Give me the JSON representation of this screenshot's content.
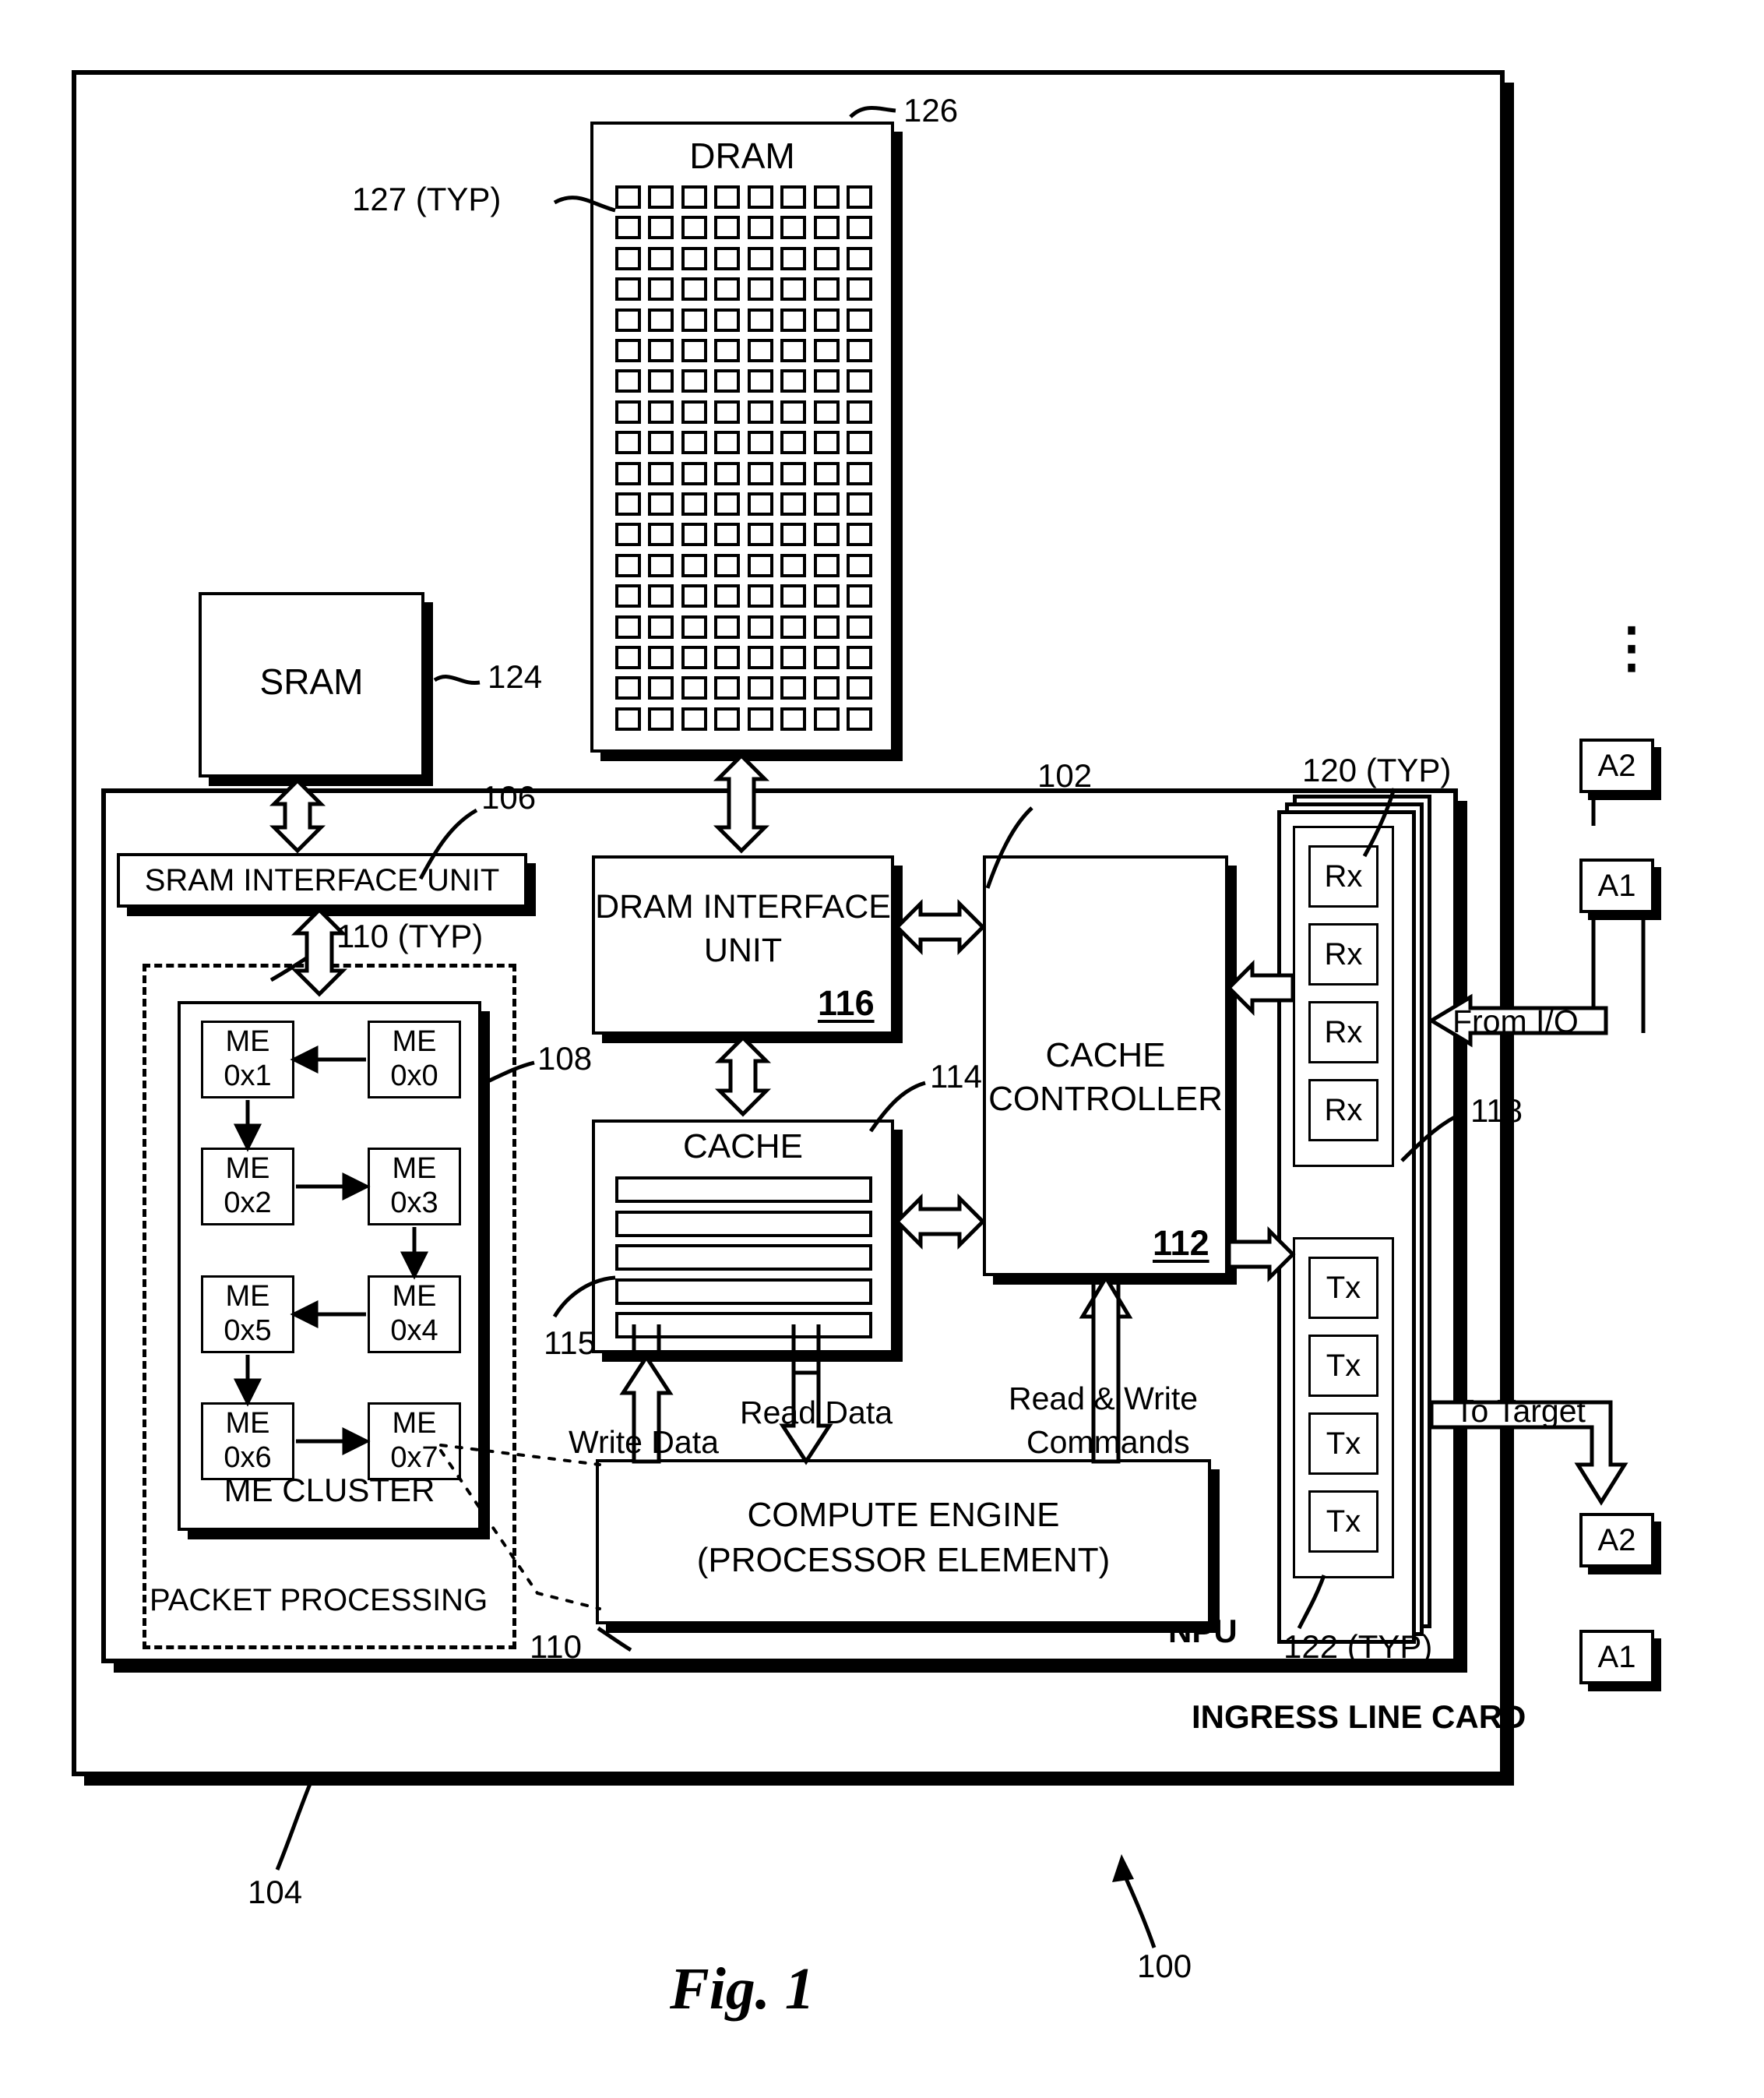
{
  "figure": {
    "caption": "Fig. 1",
    "system_ref": "100",
    "card_ref": "104",
    "card_label": "INGRESS LINE CARD",
    "npu_label": "NPU",
    "npu_ref": "102"
  },
  "memory": {
    "dram": {
      "title": "DRAM",
      "ref": "126",
      "cell_ref": "127 (TYP)",
      "grid_rows": 18,
      "grid_cols": 8
    },
    "sram": {
      "title": "SRAM",
      "ref": "124"
    }
  },
  "interfaces": {
    "sram_interface_unit": {
      "title": "SRAM INTERFACE UNIT",
      "ref": "106"
    },
    "dram_interface_unit": {
      "title_line1": "DRAM INTERFACE",
      "title_line2": "UNIT",
      "ref": "116"
    }
  },
  "cache": {
    "title": "CACHE",
    "ref": "114",
    "line_ref": "115",
    "lines": 5
  },
  "cache_controller": {
    "title_line1": "CACHE",
    "title_line2": "CONTROLLER",
    "ref": "112"
  },
  "packet_processing": {
    "label": "PACKET PROCESSING",
    "cluster_label": "ME CLUSTER",
    "cluster_ref": "108",
    "bus_ref": "110 (TYP)",
    "me_engines": [
      {
        "line1": "ME",
        "line2": "0x1"
      },
      {
        "line1": "ME",
        "line2": "0x0"
      },
      {
        "line1": "ME",
        "line2": "0x2"
      },
      {
        "line1": "ME",
        "line2": "0x3"
      },
      {
        "line1": "ME",
        "line2": "0x5"
      },
      {
        "line1": "ME",
        "line2": "0x4"
      },
      {
        "line1": "ME",
        "line2": "0x6"
      },
      {
        "line1": "ME",
        "line2": "0x7"
      }
    ]
  },
  "compute_engine": {
    "title_line1": "COMPUTE ENGINE",
    "title_line2": "(PROCESSOR ELEMENT)",
    "ref": "110"
  },
  "signals": {
    "write_data": "Write Data",
    "read_data": "Read Data",
    "read_write_commands_line1": "Read & Write",
    "read_write_commands_line2": "Commands",
    "from_io": "From I/O",
    "to_target": "To Target"
  },
  "io_ports": {
    "rx_label": "Rx",
    "rx_count": 4,
    "rx_ref": "120 (TYP)",
    "tx_label": "Tx",
    "tx_count": 4,
    "tx_ref": "122 (TYP)",
    "stack_ref": "118"
  },
  "external_blocks": {
    "vertical_ellipsis": "⋮",
    "top_a2": "A2",
    "top_a1": "A1",
    "bottom_a2": "A2",
    "bottom_a1": "A1"
  }
}
